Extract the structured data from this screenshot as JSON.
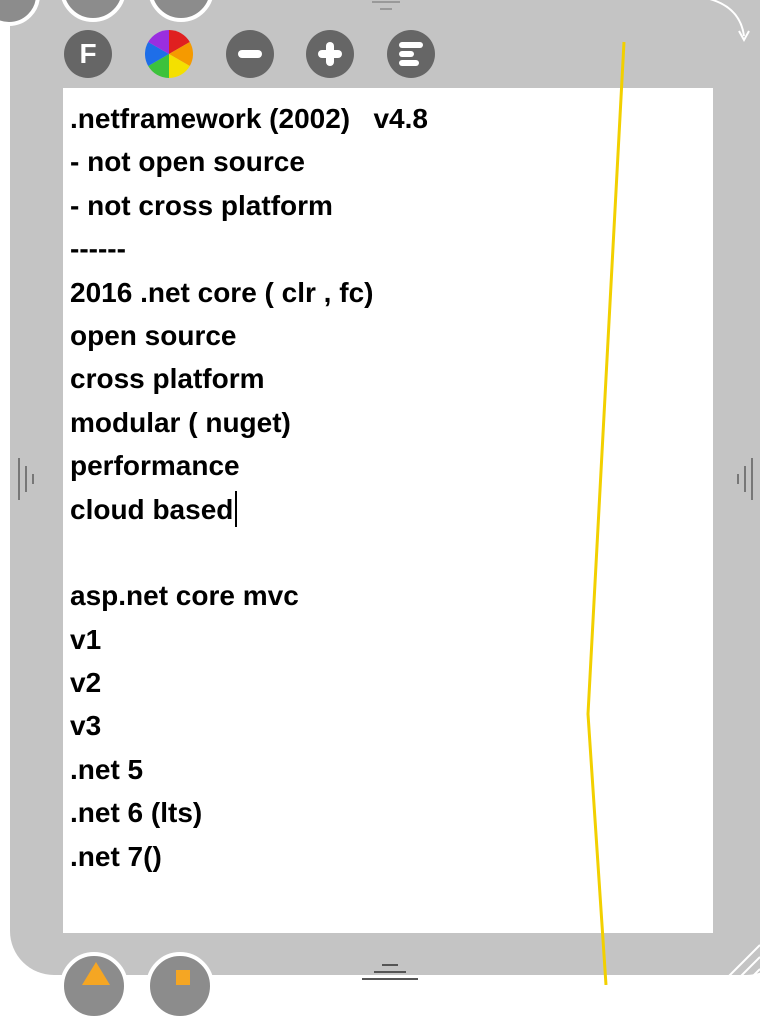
{
  "toolbar": {
    "top_buttons": [
      {
        "name": "font-button",
        "label": "F"
      },
      {
        "name": "color-button",
        "icon": "color-wheel-icon"
      },
      {
        "name": "zoom-out-button",
        "icon": "minus-icon"
      },
      {
        "name": "zoom-in-button",
        "icon": "plus-icon"
      },
      {
        "name": "align-button",
        "icon": "align-left-icon"
      }
    ],
    "bottom_buttons": [
      {
        "name": "export-button",
        "icon": "export-icon"
      },
      {
        "name": "sheet-button",
        "icon": "sheet-icon"
      }
    ]
  },
  "note": {
    "lines": [
      ".netframework (2002)   v4.8",
      "- not open source",
      "- not cross platform",
      "------",
      "2016 .net core ( clr , fc)",
      "open source",
      "cross platform",
      "modular ( nuget)",
      "performance",
      "cloud based",
      "",
      "asp.net core mvc",
      "v1",
      "v2",
      "v3",
      ".net 5",
      ".net 6 (lts)",
      ".net 7()"
    ],
    "caret_after_line": 9
  },
  "colors": {
    "frame": "#c4c4c4",
    "button": "#666666",
    "sheet": "#ffffff",
    "text": "#000000",
    "margin_line": "#f2d000",
    "accent_orange": "#f5a623"
  }
}
